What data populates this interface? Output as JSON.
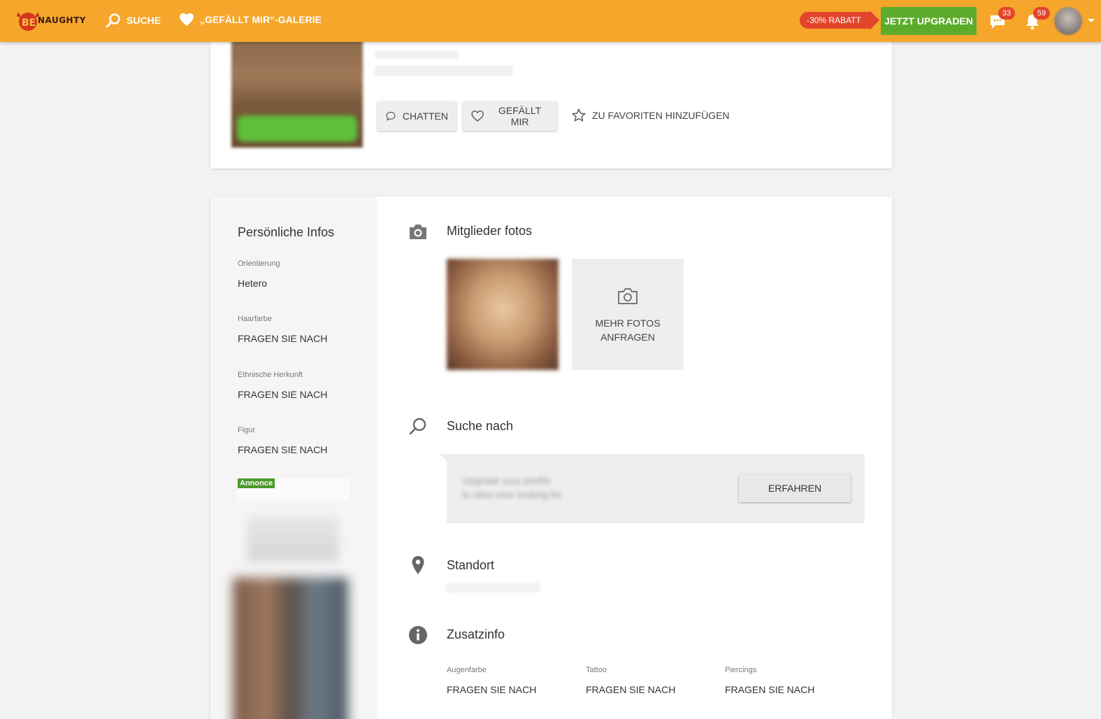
{
  "header": {
    "logo_text": "NAUGHTY",
    "nav": [
      {
        "label": "SUCHE",
        "icon": "search-icon"
      },
      {
        "label": "„GEFÄLLT MIR“-GALERIE",
        "icon": "heart-icon"
      }
    ],
    "discount_label": "-30% RABATT",
    "upgrade_label": "JETZT UPGRADEN",
    "messages_count": "33",
    "notifications_count": "59",
    "colors": {
      "bar": "#f6a62b",
      "upgrade": "#5dab2c",
      "badge": "#e2452b"
    }
  },
  "profile": {
    "actions": {
      "chat_label": "CHATTEN",
      "like_label": "GEFÄLLT MIR",
      "favorite_label": "ZU FAVORITEN HINZUFÜGEN"
    }
  },
  "sidebar": {
    "title": "Persönliche Infos",
    "fields": [
      {
        "label": "Orientierung",
        "value": "Hetero"
      },
      {
        "label": "Haarfarbe",
        "value": "FRAGEN SIE NACH"
      },
      {
        "label": "Ethnische Herkunft",
        "value": "FRAGEN SIE NACH"
      },
      {
        "label": "Figur",
        "value": "FRAGEN SIE NACH"
      }
    ],
    "ad_label": "Annonce"
  },
  "main": {
    "photos": {
      "title": "Mitglieder fotos",
      "more_photos_label": "MEHR FOTOS ANFRAGEN"
    },
    "search": {
      "title": "Suche nach",
      "blurred_text_line1": "Upgrade your profile",
      "blurred_text_line2": "to view user looking for",
      "button_label": "ERFAHREN"
    },
    "location": {
      "title": "Standort"
    },
    "extra": {
      "title": "Zusatzinfo",
      "fields": [
        {
          "label": "Augenfarbe",
          "value": "FRAGEN SIE NACH"
        },
        {
          "label": "Tattoo",
          "value": "FRAGEN SIE NACH"
        },
        {
          "label": "Piercings",
          "value": "FRAGEN SIE NACH"
        }
      ]
    }
  }
}
